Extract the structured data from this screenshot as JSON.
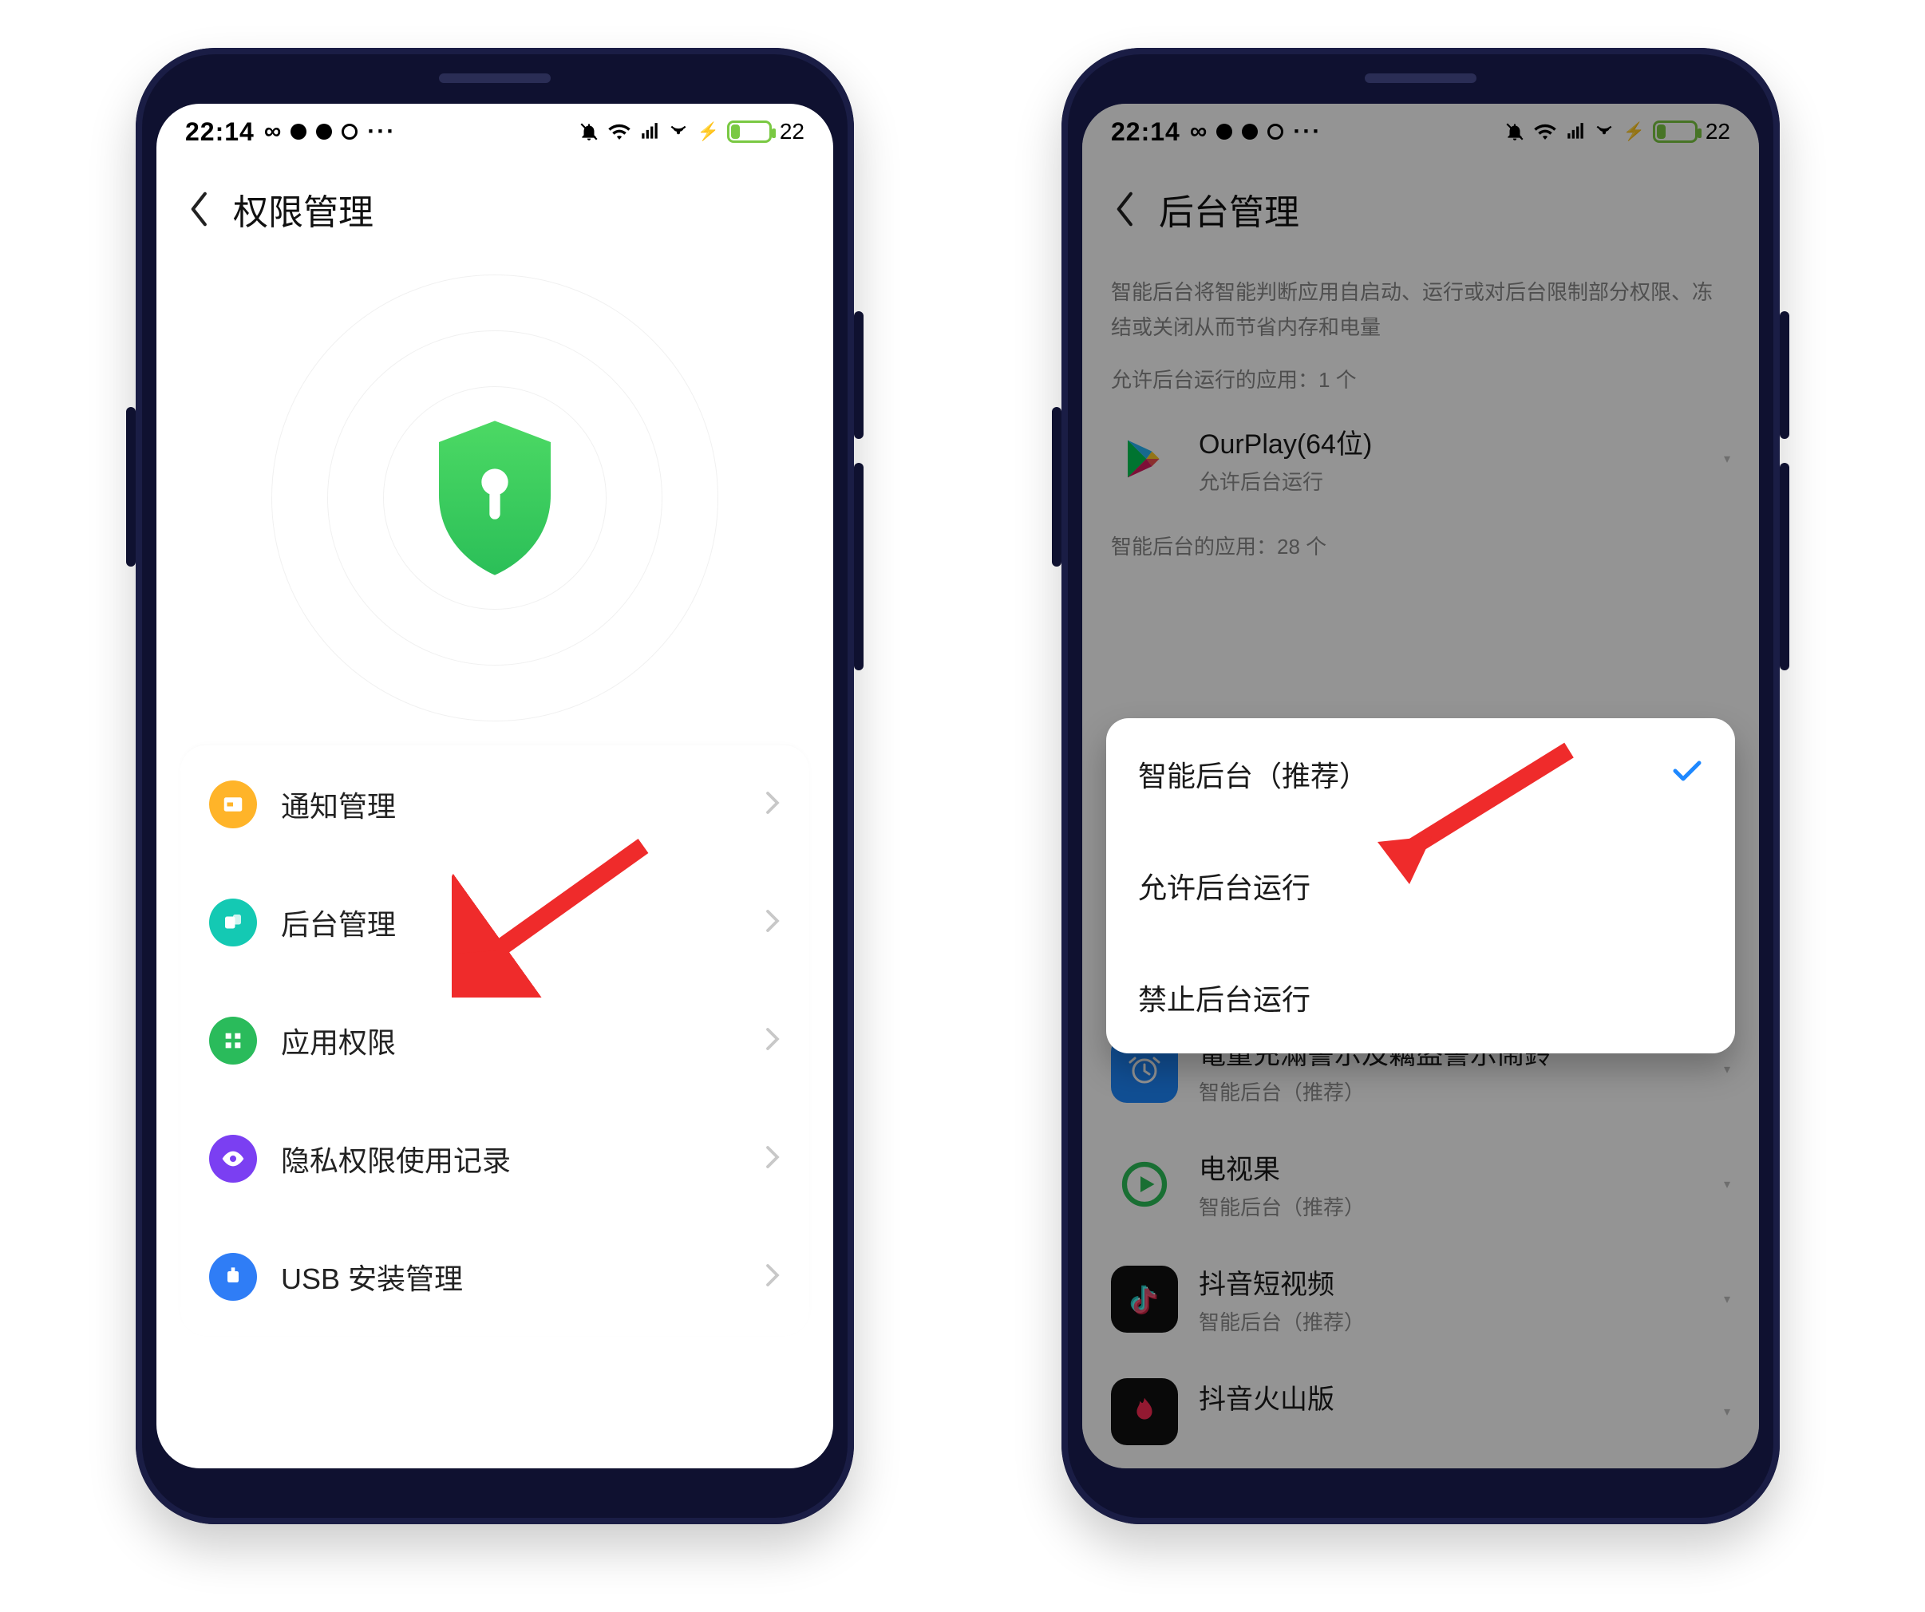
{
  "status": {
    "time": "22:14",
    "battery_pct": 22,
    "battery_text": "22"
  },
  "phone1": {
    "title": "权限管理",
    "menu": [
      {
        "label": "通知管理"
      },
      {
        "label": "后台管理"
      },
      {
        "label": "应用权限"
      },
      {
        "label": "隐私权限使用记录"
      },
      {
        "label": "USB 安装管理"
      }
    ]
  },
  "phone2": {
    "title": "后台管理",
    "description": "智能后台将智能判断应用自启动、运行或对后台限制部分权限、冻结或关闭从而节省内存和电量",
    "allowed_note": "允许后台运行的应用：1 个",
    "allowed_app": {
      "name": "OurPlay(64位)",
      "sub": "允许后台运行"
    },
    "smart_note": "智能后台的应用：28 个",
    "smart_sub_default": "智能后台（推荐）",
    "apps": [
      {
        "name": "電量充滿警示及竊盜警示鬧鈴"
      },
      {
        "name": "电视果"
      },
      {
        "name": "抖音短视频"
      },
      {
        "name": "抖音火山版"
      }
    ],
    "sheet": {
      "options": [
        {
          "label": "智能后台（推荐）",
          "selected": true
        },
        {
          "label": "允许后台运行",
          "selected": false
        },
        {
          "label": "禁止后台运行",
          "selected": false
        }
      ]
    }
  }
}
